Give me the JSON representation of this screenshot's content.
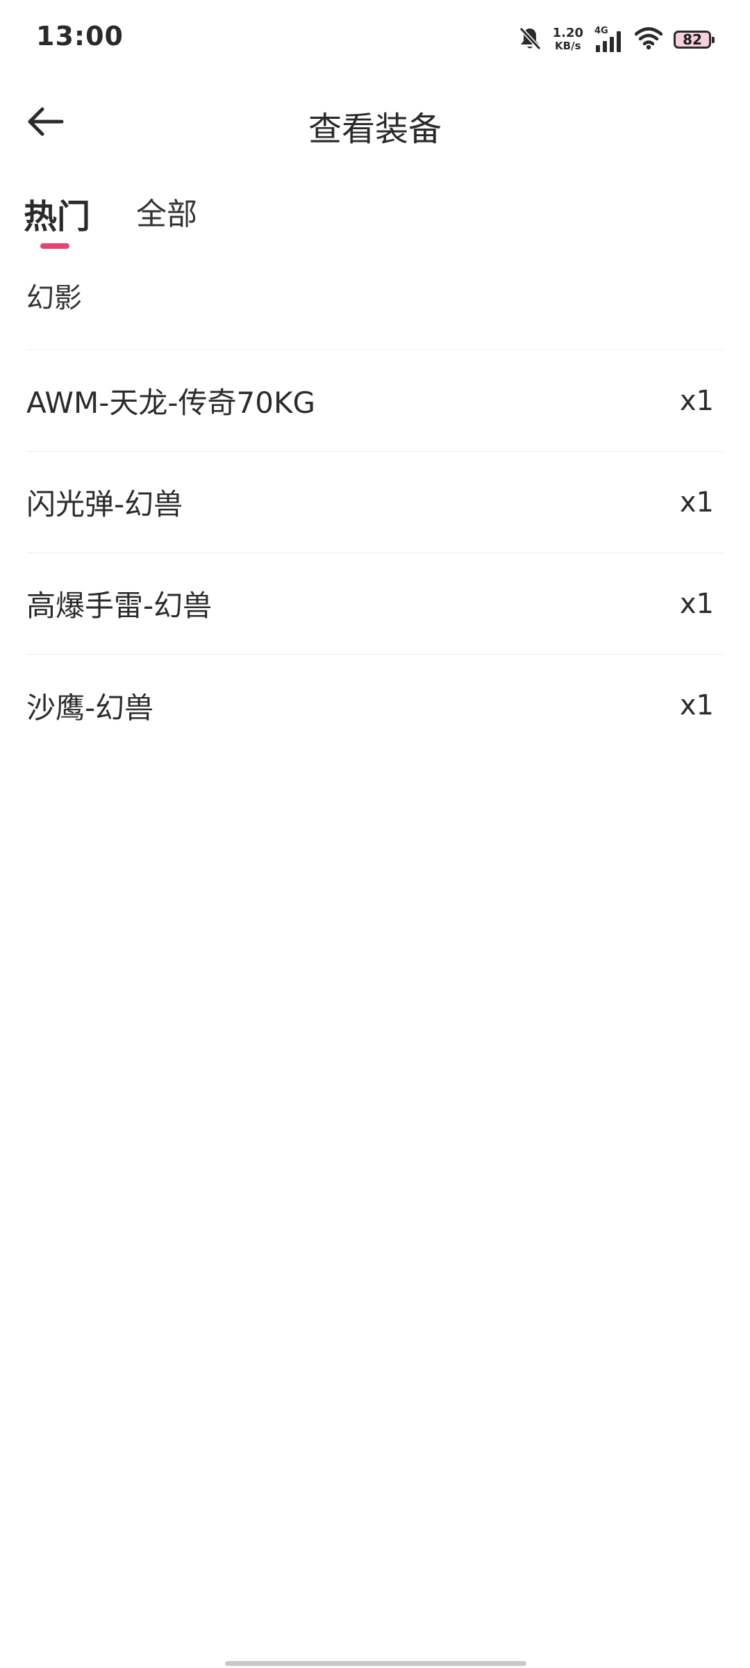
{
  "status_bar": {
    "time": "13:00",
    "net_speed_value": "1.20",
    "net_speed_unit": "KB/s",
    "network_type": "4G",
    "battery_level": "82",
    "icons": [
      "bell-muted-icon",
      "signal-icon",
      "wifi-icon",
      "battery-icon"
    ]
  },
  "header": {
    "title": "查看装备",
    "back_icon": "arrow-left-icon"
  },
  "tabs": [
    {
      "label": "热门",
      "active": true
    },
    {
      "label": "全部",
      "active": false
    }
  ],
  "list": {
    "section_title": "幻影",
    "items": [
      {
        "name": "AWM-天龙-传奇70KG",
        "qty": "x1"
      },
      {
        "name": "闪光弹-幻兽",
        "qty": "x1"
      },
      {
        "name": "高爆手雷-幻兽",
        "qty": "x1"
      },
      {
        "name": "沙鹰-幻兽",
        "qty": "x1"
      }
    ]
  },
  "colors": {
    "accent": "#e7426f",
    "text": "#2b2b2b",
    "divider": "#ededed",
    "background": "#ffffff"
  }
}
